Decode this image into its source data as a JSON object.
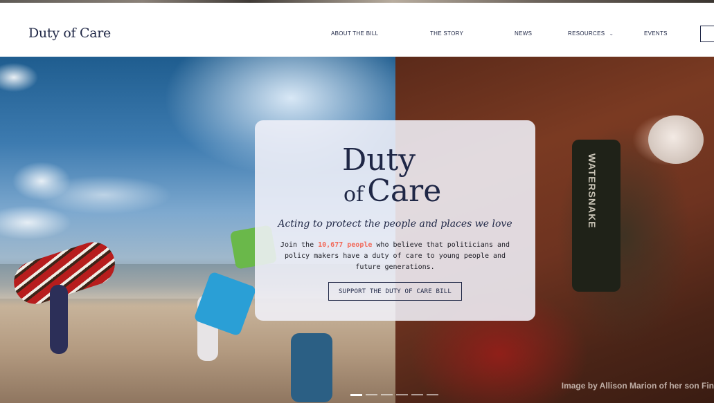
{
  "header": {
    "logo": "Duty of Care",
    "nav": [
      {
        "label": "ABOUT THE BILL"
      },
      {
        "label": "THE STORY"
      },
      {
        "label": "NEWS"
      },
      {
        "label": "RESOURCES",
        "has_dropdown": true
      },
      {
        "label": "EVENTS"
      }
    ]
  },
  "hero": {
    "card": {
      "logo_line1": "Duty",
      "logo_line2_of": "of",
      "logo_line2_care": "Care",
      "tagline": "Acting to protect the people and places we love",
      "body_prefix": "Join the ",
      "supporter_count": "10,677 people",
      "body_suffix": " who believe that politicians and policy makers have a duty of care to young people and future generations.",
      "cta_label": "SUPPORT THE DUTY OF CARE BILL"
    },
    "vest_text": "WATERSNAKE",
    "photo_credit": "Image by Allison Marion of her son Fin",
    "slides": {
      "count": 6,
      "active_index": 0
    }
  },
  "colors": {
    "brand_navy": "#1f2746",
    "accent_coral": "#f26a5a"
  }
}
